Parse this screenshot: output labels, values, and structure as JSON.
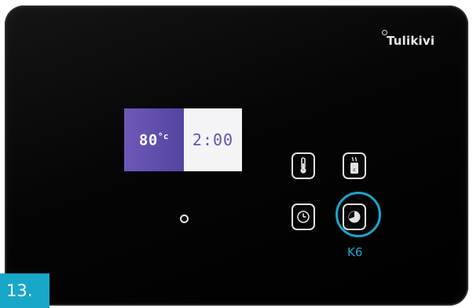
{
  "brand": {
    "name": "Tulikivi",
    "mark_icon": "registered-dot-icon"
  },
  "display": {
    "temperature_value": "80",
    "temperature_unit": "°c",
    "time_value": "2:00"
  },
  "buttons": [
    {
      "name": "thermometer-button",
      "icon": "thermometer-icon"
    },
    {
      "name": "heating-button",
      "icon": "heat-element-icon"
    },
    {
      "name": "clock-button",
      "icon": "clock-icon"
    },
    {
      "name": "timer-button",
      "icon": "timer-icon"
    }
  ],
  "highlight": {
    "label": "K6",
    "color": "#16a7cf"
  },
  "step": {
    "number": "13."
  },
  "colors": {
    "display_purple": "#5b49a8",
    "accent_cyan": "#19a7c9",
    "panel_black": "#000000"
  }
}
